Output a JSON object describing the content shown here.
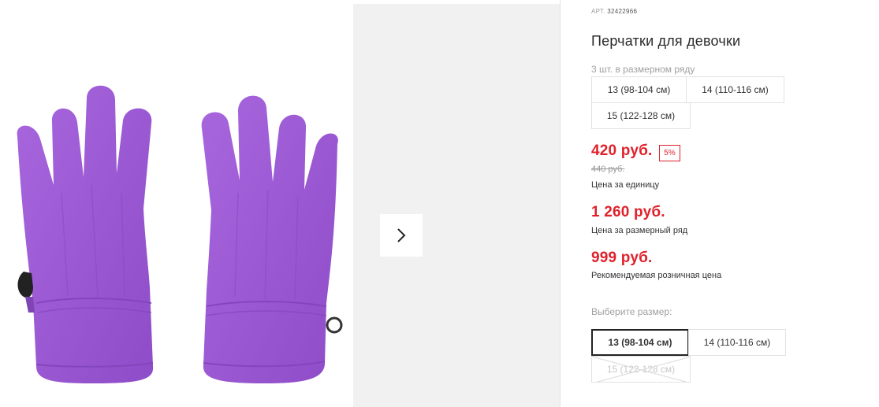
{
  "product": {
    "sku_label": "АРТ.",
    "sku": "32422966",
    "title": "Перчатки для девочки"
  },
  "pack": {
    "label": "3 шт. в размерном ряду",
    "sizes": [
      "13 (98-104 см)",
      "14 (110-116 см)",
      "15 (122-128 см)"
    ]
  },
  "pricing": {
    "price": "420 руб.",
    "discount": "5%",
    "old_price": "440 руб.",
    "unit_label": "Цена за единицу",
    "row_price": "1 260 руб.",
    "row_label": "Цена за размерный ряд",
    "rrp_price": "999 руб.",
    "rrp_label": "Рекомендуемая розничная цена"
  },
  "size_picker": {
    "label": "Выберите размер:",
    "options": [
      {
        "label": "13 (98-104 см)",
        "state": "selected"
      },
      {
        "label": "14 (110-116 см)",
        "state": "available"
      },
      {
        "label": "15 (122-128 см)",
        "state": "unavailable"
      }
    ]
  },
  "gallery": {
    "next_icon": "chevron-right-icon",
    "product_color": "#9b5bd4"
  },
  "colors": {
    "accent_red": "#e0212b",
    "muted": "#a0a0a0"
  }
}
